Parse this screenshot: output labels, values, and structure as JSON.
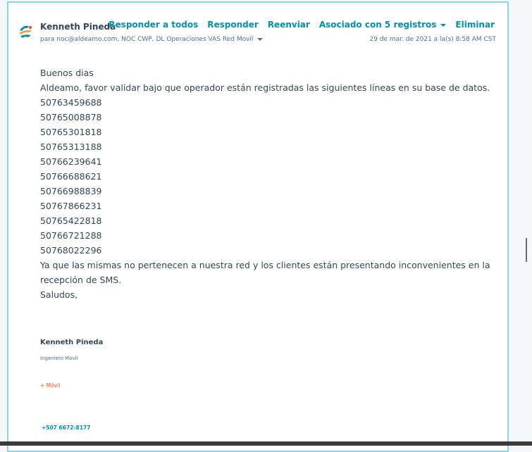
{
  "email": {
    "sender": "Kenneth Pineda",
    "recipients": "para noc@aldeamo.com, NOC CWP, DL Operaciones VAS Red Movil",
    "date": "29 de mar. de 2021 a la(s) 8:58 AM CST"
  },
  "actions": {
    "reply_all": "Responder a todos",
    "reply": "Responder",
    "forward": "Reenviar",
    "associated": "Asociado con 5 registros",
    "delete": "Eliminar"
  },
  "body": {
    "greeting": "Buenos dias",
    "intro": "Aldeamo, favor validar bajo que operador están registradas las siguientes líneas en su base de datos.",
    "numbers": [
      "50763459688",
      "50765008878",
      "50765301818",
      "50765313188",
      "50766239641",
      "50766688621",
      "50766988839",
      "50767866231",
      "50765422818",
      "50766721288",
      "50768022296"
    ],
    "closing": "Ya que las mismas no pertenecen a nuestra red y los clientes están presentando inconvenientes en la recepción de SMS.",
    "regards": "Saludos,"
  },
  "signature": {
    "name": "Kenneth Pineda",
    "title": "Ingeniero Movil",
    "brand": "+ Móvil",
    "phone": "+507 6672-8177"
  },
  "colors": {
    "accent": "#0091ae",
    "text": "#33475b",
    "brand_orange": "#e8501f",
    "card_border": "#8fd3e6"
  }
}
